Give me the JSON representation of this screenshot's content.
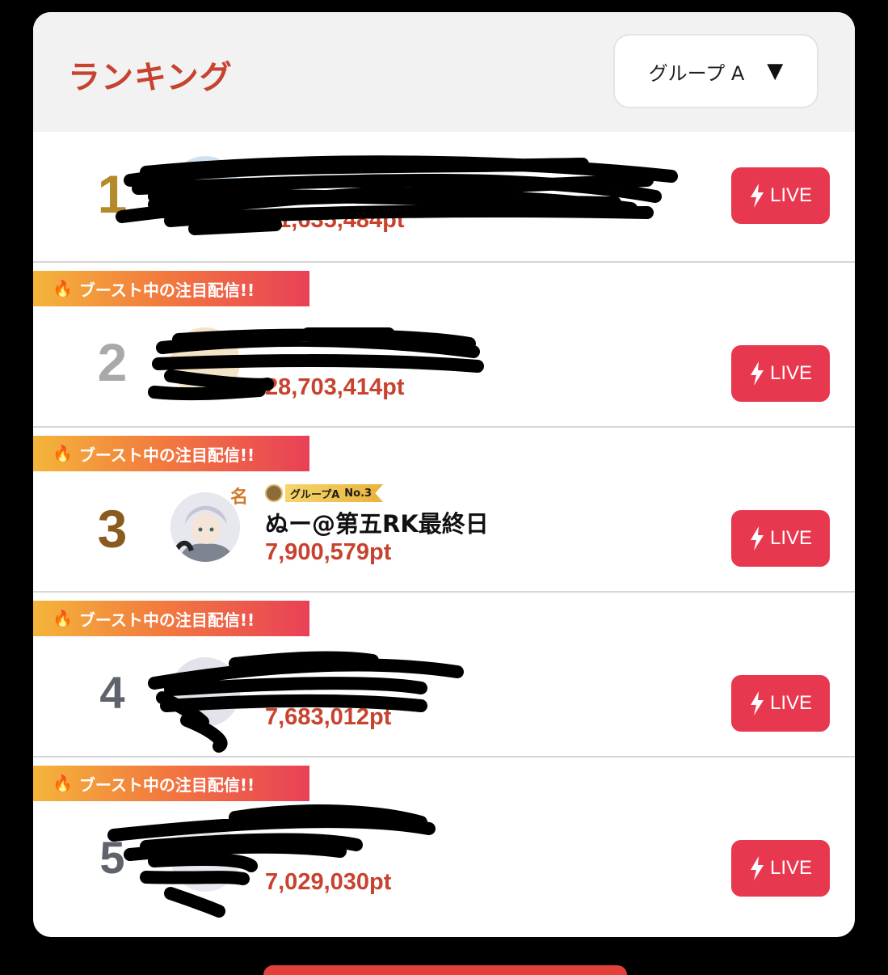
{
  "header": {
    "title": "ランキング",
    "group_select": {
      "label": "グループ A",
      "arrow": "▼"
    }
  },
  "colors": {
    "accent": "#c7432f",
    "live_button": "#e8384f",
    "rank_gold": "#b58a2a",
    "rank_silver": "#a9a9a9",
    "rank_bronze": "#8a5a1f",
    "rank_other": "#5f636b"
  },
  "boost_label": "ブースト中の注目配信!!",
  "live_label": "LIVE",
  "rows": [
    {
      "rank": "1",
      "points": "31,635,484pt",
      "boost": false,
      "name": "",
      "redacted": true,
      "live_icon": "bolt-icon"
    },
    {
      "rank": "2",
      "points": "28,703,414pt",
      "boost": true,
      "name": "",
      "redacted": true,
      "live_icon": "bolt-icon"
    },
    {
      "rank": "3",
      "points": "7,900,579pt",
      "boost": true,
      "name": "ぬー@第五RK最終日",
      "redacted": false,
      "badge": {
        "text1": "グループA",
        "text2": "No.3"
      },
      "mei": "名",
      "live_icon": "bolt-icon"
    },
    {
      "rank": "4",
      "points": "7,683,012pt",
      "boost": true,
      "name": "",
      "redacted": true,
      "live_icon": "bolt-icon"
    },
    {
      "rank": "5",
      "points": "7,029,030pt",
      "boost": true,
      "name": "",
      "redacted": true,
      "live_icon": "bolt-icon"
    }
  ]
}
